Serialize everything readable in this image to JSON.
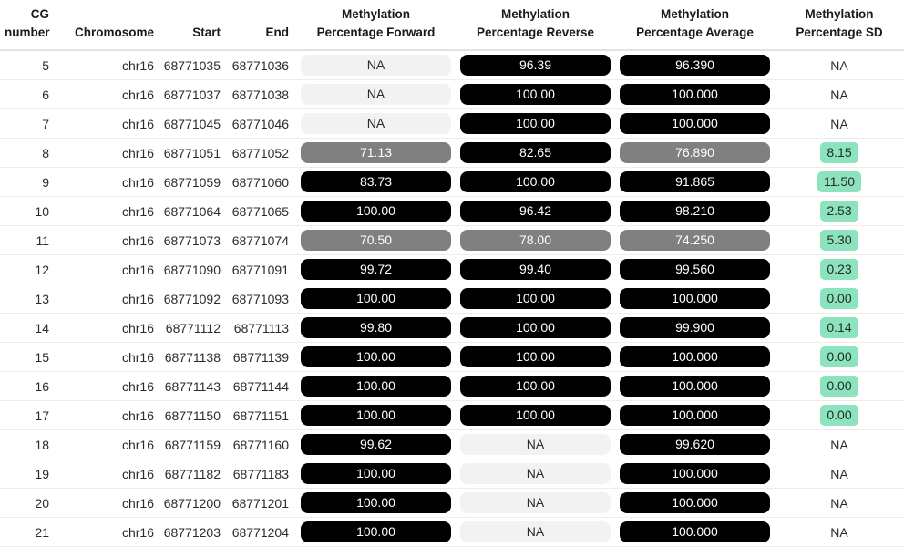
{
  "table": {
    "columns": [
      {
        "key": "cg_number",
        "label": "CG\nnumber",
        "label_line1": "CG",
        "label_line2": "number",
        "align": "right"
      },
      {
        "key": "chromosome",
        "label": "Chromosome",
        "align": "right"
      },
      {
        "key": "start",
        "label": "Start",
        "align": "right"
      },
      {
        "key": "end",
        "label": "End",
        "align": "right"
      },
      {
        "key": "meth_forward",
        "label": "Methylation Percentage Forward",
        "label_line1": "Methylation",
        "label_line2": "Percentage Forward",
        "align": "center"
      },
      {
        "key": "meth_reverse",
        "label": "Methylation Percentage Reverse",
        "label_line1": "Methylation",
        "label_line2": "Percentage Reverse",
        "align": "center"
      },
      {
        "key": "meth_average",
        "label": "Methylation Percentage Average",
        "label_line1": "Methylation",
        "label_line2": "Percentage Average",
        "align": "center"
      },
      {
        "key": "meth_sd",
        "label": "Methylation Percentage SD",
        "label_line1": "Methylation",
        "label_line2": "Percentage SD",
        "align": "center"
      }
    ],
    "colors": {
      "pill_dark": "#000000",
      "pill_mid": "#808080",
      "pill_na": "#f2f2f2",
      "sd_badge": "#8ce3bd",
      "row_divider": "#ededed",
      "header_divider": "#e3e3e3",
      "text": "#2b2b2b",
      "pill_dark_text": "#ffffff"
    },
    "rows": [
      {
        "cg_number": "5",
        "chromosome": "chr16",
        "start": "68771035",
        "end": "68771036",
        "meth_forward": "NA",
        "meth_forward_level": "na",
        "meth_reverse": "96.39",
        "meth_reverse_level": "dark",
        "meth_average": "96.390",
        "meth_average_level": "dark",
        "meth_sd": "NA",
        "meth_sd_badge": false
      },
      {
        "cg_number": "6",
        "chromosome": "chr16",
        "start": "68771037",
        "end": "68771038",
        "meth_forward": "NA",
        "meth_forward_level": "na",
        "meth_reverse": "100.00",
        "meth_reverse_level": "dark",
        "meth_average": "100.000",
        "meth_average_level": "dark",
        "meth_sd": "NA",
        "meth_sd_badge": false
      },
      {
        "cg_number": "7",
        "chromosome": "chr16",
        "start": "68771045",
        "end": "68771046",
        "meth_forward": "NA",
        "meth_forward_level": "na",
        "meth_reverse": "100.00",
        "meth_reverse_level": "dark",
        "meth_average": "100.000",
        "meth_average_level": "dark",
        "meth_sd": "NA",
        "meth_sd_badge": false
      },
      {
        "cg_number": "8",
        "chromosome": "chr16",
        "start": "68771051",
        "end": "68771052",
        "meth_forward": "71.13",
        "meth_forward_level": "mid",
        "meth_reverse": "82.65",
        "meth_reverse_level": "dark",
        "meth_average": "76.890",
        "meth_average_level": "mid",
        "meth_sd": "8.15",
        "meth_sd_badge": true
      },
      {
        "cg_number": "9",
        "chromosome": "chr16",
        "start": "68771059",
        "end": "68771060",
        "meth_forward": "83.73",
        "meth_forward_level": "dark",
        "meth_reverse": "100.00",
        "meth_reverse_level": "dark",
        "meth_average": "91.865",
        "meth_average_level": "dark",
        "meth_sd": "11.50",
        "meth_sd_badge": true
      },
      {
        "cg_number": "10",
        "chromosome": "chr16",
        "start": "68771064",
        "end": "68771065",
        "meth_forward": "100.00",
        "meth_forward_level": "dark",
        "meth_reverse": "96.42",
        "meth_reverse_level": "dark",
        "meth_average": "98.210",
        "meth_average_level": "dark",
        "meth_sd": "2.53",
        "meth_sd_badge": true
      },
      {
        "cg_number": "11",
        "chromosome": "chr16",
        "start": "68771073",
        "end": "68771074",
        "meth_forward": "70.50",
        "meth_forward_level": "mid",
        "meth_reverse": "78.00",
        "meth_reverse_level": "mid",
        "meth_average": "74.250",
        "meth_average_level": "mid",
        "meth_sd": "5.30",
        "meth_sd_badge": true
      },
      {
        "cg_number": "12",
        "chromosome": "chr16",
        "start": "68771090",
        "end": "68771091",
        "meth_forward": "99.72",
        "meth_forward_level": "dark",
        "meth_reverse": "99.40",
        "meth_reverse_level": "dark",
        "meth_average": "99.560",
        "meth_average_level": "dark",
        "meth_sd": "0.23",
        "meth_sd_badge": true
      },
      {
        "cg_number": "13",
        "chromosome": "chr16",
        "start": "68771092",
        "end": "68771093",
        "meth_forward": "100.00",
        "meth_forward_level": "dark",
        "meth_reverse": "100.00",
        "meth_reverse_level": "dark",
        "meth_average": "100.000",
        "meth_average_level": "dark",
        "meth_sd": "0.00",
        "meth_sd_badge": true
      },
      {
        "cg_number": "14",
        "chromosome": "chr16",
        "start": "68771112",
        "end": "68771113",
        "meth_forward": "99.80",
        "meth_forward_level": "dark",
        "meth_reverse": "100.00",
        "meth_reverse_level": "dark",
        "meth_average": "99.900",
        "meth_average_level": "dark",
        "meth_sd": "0.14",
        "meth_sd_badge": true
      },
      {
        "cg_number": "15",
        "chromosome": "chr16",
        "start": "68771138",
        "end": "68771139",
        "meth_forward": "100.00",
        "meth_forward_level": "dark",
        "meth_reverse": "100.00",
        "meth_reverse_level": "dark",
        "meth_average": "100.000",
        "meth_average_level": "dark",
        "meth_sd": "0.00",
        "meth_sd_badge": true
      },
      {
        "cg_number": "16",
        "chromosome": "chr16",
        "start": "68771143",
        "end": "68771144",
        "meth_forward": "100.00",
        "meth_forward_level": "dark",
        "meth_reverse": "100.00",
        "meth_reverse_level": "dark",
        "meth_average": "100.000",
        "meth_average_level": "dark",
        "meth_sd": "0.00",
        "meth_sd_badge": true
      },
      {
        "cg_number": "17",
        "chromosome": "chr16",
        "start": "68771150",
        "end": "68771151",
        "meth_forward": "100.00",
        "meth_forward_level": "dark",
        "meth_reverse": "100.00",
        "meth_reverse_level": "dark",
        "meth_average": "100.000",
        "meth_average_level": "dark",
        "meth_sd": "0.00",
        "meth_sd_badge": true
      },
      {
        "cg_number": "18",
        "chromosome": "chr16",
        "start": "68771159",
        "end": "68771160",
        "meth_forward": "99.62",
        "meth_forward_level": "dark",
        "meth_reverse": "NA",
        "meth_reverse_level": "na",
        "meth_average": "99.620",
        "meth_average_level": "dark",
        "meth_sd": "NA",
        "meth_sd_badge": false
      },
      {
        "cg_number": "19",
        "chromosome": "chr16",
        "start": "68771182",
        "end": "68771183",
        "meth_forward": "100.00",
        "meth_forward_level": "dark",
        "meth_reverse": "NA",
        "meth_reverse_level": "na",
        "meth_average": "100.000",
        "meth_average_level": "dark",
        "meth_sd": "NA",
        "meth_sd_badge": false
      },
      {
        "cg_number": "20",
        "chromosome": "chr16",
        "start": "68771200",
        "end": "68771201",
        "meth_forward": "100.00",
        "meth_forward_level": "dark",
        "meth_reverse": "NA",
        "meth_reverse_level": "na",
        "meth_average": "100.000",
        "meth_average_level": "dark",
        "meth_sd": "NA",
        "meth_sd_badge": false
      },
      {
        "cg_number": "21",
        "chromosome": "chr16",
        "start": "68771203",
        "end": "68771204",
        "meth_forward": "100.00",
        "meth_forward_level": "dark",
        "meth_reverse": "NA",
        "meth_reverse_level": "na",
        "meth_average": "100.000",
        "meth_average_level": "dark",
        "meth_sd": "NA",
        "meth_sd_badge": false
      }
    ]
  }
}
